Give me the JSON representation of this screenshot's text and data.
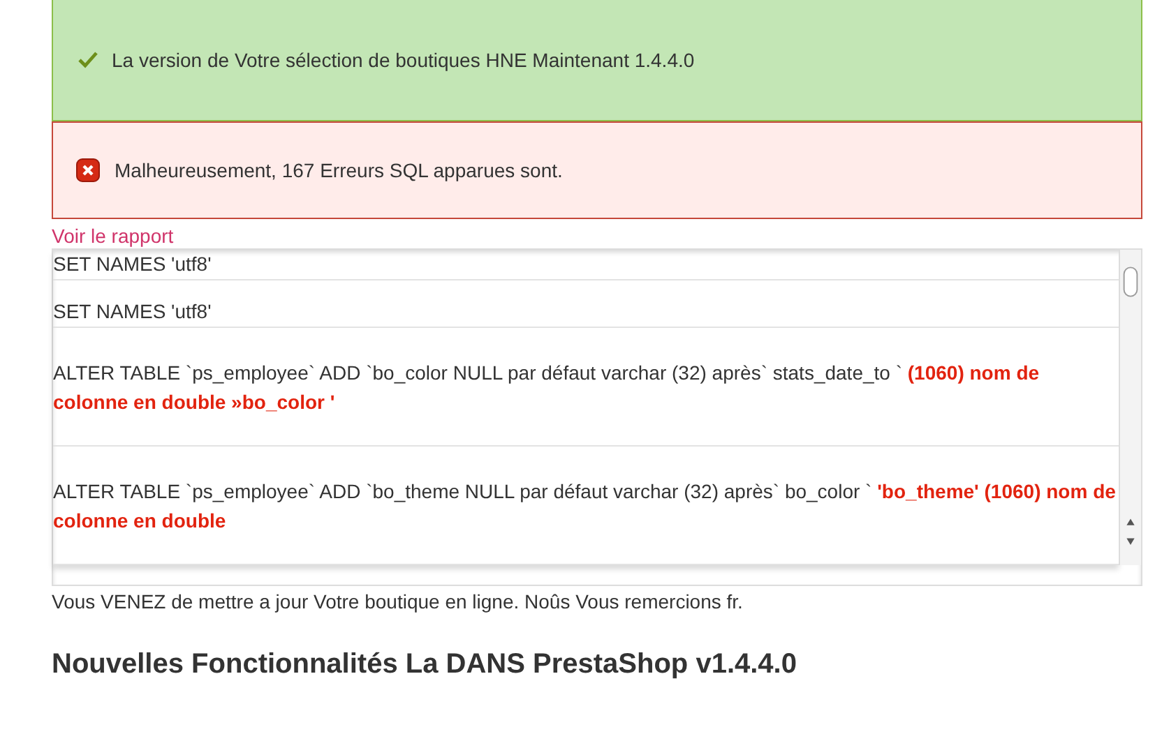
{
  "success": {
    "text": "La version de Votre sélection de boutiques HNE Maintenant 1.4.4.0"
  },
  "error": {
    "text": "Malheureusement, 167 Erreurs SQL apparues sont."
  },
  "report_link": "Voir le rapport",
  "log": [
    {
      "text": "SET NAMES 'utf8'"
    },
    {
      "text": "SET NAMES 'utf8'"
    },
    {
      "text": "ALTER TABLE `ps_employee` ADD `bo_color NULL par défaut varchar (32) après` stats_date_to ` **(1060) nom de colonne en double »bo_color '**"
    },
    {
      "text": "ALTER TABLE `ps_employee` ADD `bo_theme NULL par défaut varchar (32) après` bo_color ` **'bo_theme' (1060) nom de colonne en double**"
    }
  ],
  "footer_text": "Vous VENEZ de mettre a jour Votre boutique en ligne. Noûs Vous remercions fr.",
  "heading": "Nouvelles Fonctionnalités La DANS PrestaShop v1.4.4.0"
}
